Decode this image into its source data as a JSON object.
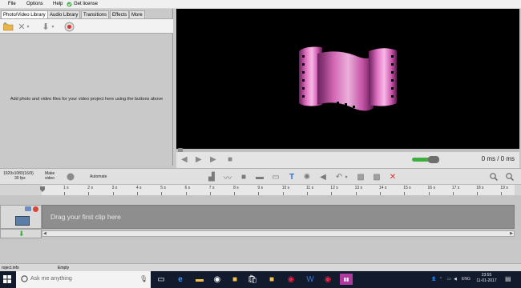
{
  "menu": {
    "file": "File",
    "options": "Options",
    "help": "Help",
    "get_license": "Get license"
  },
  "tabs": [
    {
      "label": "Photo/Video Library"
    },
    {
      "label": "Audio Library"
    },
    {
      "label": "Transitions"
    },
    {
      "label": "Effects"
    },
    {
      "label": "More"
    }
  ],
  "library": {
    "empty_message": "Add photo and video files for your video project here using the buttons above"
  },
  "preview": {
    "time": "0 ms / 0 ms",
    "volume_level": 0.6
  },
  "timeline_toolbar": {
    "resolution": "1920x1080(16/9)",
    "fps": "30 fps",
    "make_video": "Make video",
    "automate": "Automate"
  },
  "ruler": {
    "ticks": [
      "1 s",
      "2 s",
      "3 s",
      "4 s",
      "5 s",
      "6 s",
      "7 s",
      "8 s",
      "9 s",
      "10 s",
      "11 s",
      "12 s",
      "13 s",
      "14 s",
      "15 s",
      "16 s",
      "17 s",
      "18 s",
      "19 s"
    ]
  },
  "track": {
    "drag_message": "Drag your first clip here"
  },
  "status": {
    "left": "roject.info",
    "center": "Empty"
  },
  "taskbar": {
    "search_placeholder": "Ask me anything",
    "language": "ENG",
    "time": "23:55",
    "date": "11-01-2017"
  },
  "colors": {
    "accent_green": "#3fae3f",
    "delete_red": "#e03030",
    "text_tool_blue": "#2a6fd0",
    "reel_pink": "#e070c0"
  }
}
